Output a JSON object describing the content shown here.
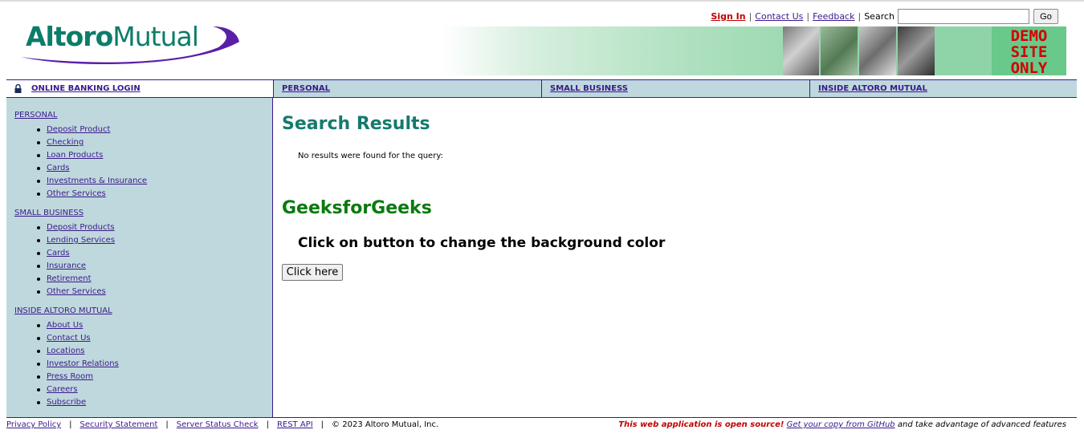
{
  "header": {
    "logo_text_1": "Altoro",
    "logo_text_2": "Mutual",
    "sign_in": "Sign In",
    "contact_us": "Contact Us",
    "feedback": "Feedback",
    "search_label": "Search",
    "search_value": "",
    "go_button": "Go",
    "demo_line1": "DEMO",
    "demo_line2": "SITE",
    "demo_line3": "ONLY"
  },
  "nav": {
    "login": "ONLINE BANKING LOGIN",
    "personal": "PERSONAL",
    "small_business": "SMALL BUSINESS",
    "inside": "INSIDE ALTORO MUTUAL"
  },
  "sidebar": {
    "personal_heading": "PERSONAL",
    "personal_items": [
      "Deposit Product",
      "Checking",
      "Loan Products",
      "Cards",
      "Investments & Insurance",
      "Other Services"
    ],
    "business_heading": "SMALL BUSINESS",
    "business_items": [
      "Deposit Products",
      "Lending Services",
      "Cards",
      "Insurance",
      "Retirement",
      "Other Services"
    ],
    "inside_heading": "INSIDE ALTORO MUTUAL",
    "inside_items": [
      "About Us",
      "Contact Us",
      "Locations",
      "Investor Relations",
      "Press Room",
      "Careers",
      "Subscribe"
    ]
  },
  "main": {
    "title": "Search Results",
    "no_results": "No results were found for the query:",
    "gfg_title": "GeeksforGeeks",
    "instruction": "Click on button to change the background color",
    "button": "Click here"
  },
  "footer": {
    "privacy": "Privacy Policy",
    "security": "Security Statement",
    "server_status": "Server Status Check",
    "rest_api": "REST API",
    "copyright": "© 2023 Altoro Mutual, Inc.",
    "open_source": "This web application is open source!",
    "github_link": "Get your copy from GitHub",
    "tail": "and take advantage of advanced features"
  },
  "colors": {
    "brand_green": "#0b7d69",
    "nav_bg": "#bfd8dd",
    "link": "#3a1a8c",
    "alert_red": "#c00000"
  }
}
